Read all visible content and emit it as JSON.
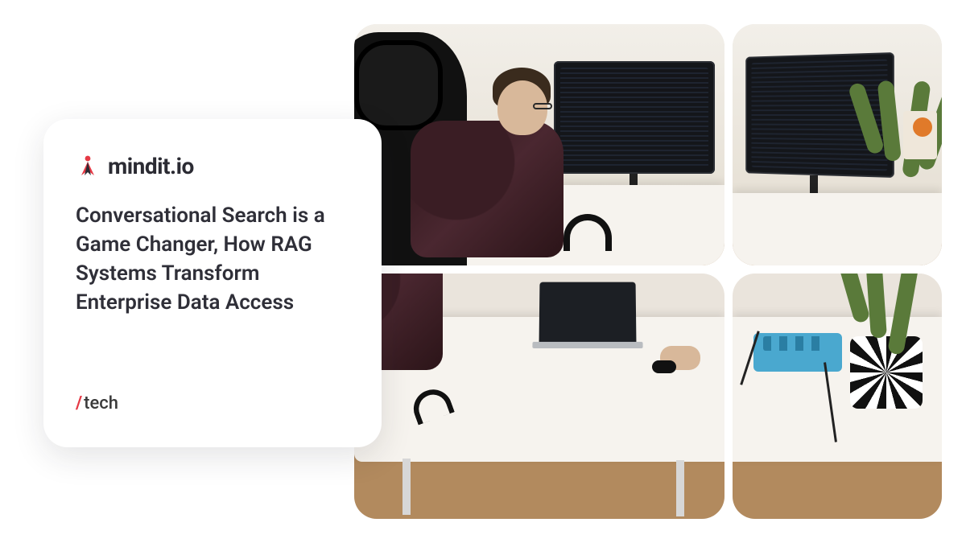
{
  "brand": {
    "name": "mindit.io",
    "accent": "#e53945"
  },
  "card": {
    "headline": "Conversational Search is a Game Changer, How RAG Systems Transform Enterprise Data Access",
    "category_slash": "/",
    "category": "tech"
  },
  "image": {
    "alt": "Developer wearing glasses and a dark knit sweater working at a white desk with a laptop and two large monitors showing code; a potted snake plant and a patterned pot sit to the right; high-back black office chair behind him.",
    "grid": "2x2 rounded-corner tiles"
  }
}
